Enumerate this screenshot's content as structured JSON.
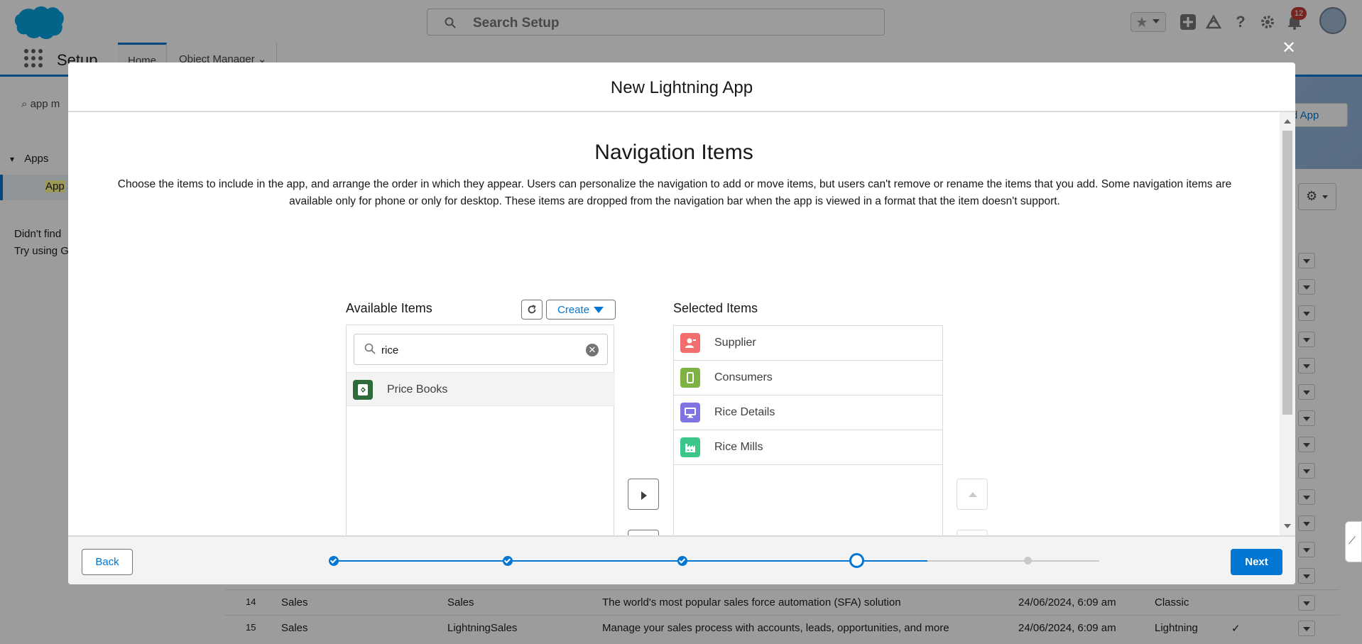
{
  "header": {
    "search_placeholder": "Search Setup",
    "notification_count": "12"
  },
  "nav": {
    "app_name": "Setup",
    "tabs": [
      {
        "label": "Home",
        "active": true
      },
      {
        "label": "Object Manager",
        "active": false
      }
    ]
  },
  "left_panel": {
    "quick_find_value": "app m",
    "tree_root": "Apps",
    "tree_child": "App",
    "help_line1": "Didn't find",
    "help_line2": "Try using G"
  },
  "background_page": {
    "new_app_button": "d App",
    "rows": [
      {
        "num": "14",
        "app_name": "Sales",
        "developer_name": "Sales",
        "description": "The world's most popular sales force automation (SFA) solution",
        "last_modified": "24/06/2024, 6:09 am",
        "app_type": "Classic",
        "visible_in_lightning": false
      },
      {
        "num": "15",
        "app_name": "Sales",
        "developer_name": "LightningSales",
        "description": "Manage your sales process with accounts, leads, opportunities, and more",
        "last_modified": "24/06/2024, 6:09 am",
        "app_type": "Lightning",
        "visible_in_lightning": true
      }
    ]
  },
  "modal": {
    "title": "New Lightning App",
    "section_title": "Navigation Items",
    "description": "Choose the items to include in the app, and arrange the order in which they appear. Users can personalize the navigation to add or move items, but users can't remove or rename the items that you add. Some navigation items are available only for phone or only for desktop. These items are dropped from the navigation bar when the app is viewed in a format that the item doesn't support.",
    "available": {
      "label": "Available Items",
      "create_label": "Create",
      "search_value": "rice",
      "items": [
        {
          "label": "Price Books",
          "icon": "price-book-icon",
          "color": "#2e6b3a"
        }
      ]
    },
    "selected": {
      "label": "Selected Items",
      "items": [
        {
          "label": "Supplier",
          "icon": "person-icon",
          "color": "#f26d6d"
        },
        {
          "label": "Consumers",
          "icon": "phone-icon",
          "color": "#7cb342"
        },
        {
          "label": "Rice Details",
          "icon": "monitor-icon",
          "color": "#7f74e1"
        },
        {
          "label": "Rice Mills",
          "icon": "factory-icon",
          "color": "#3cc68a"
        }
      ]
    },
    "footer": {
      "back_label": "Back",
      "next_label": "Next",
      "progress": {
        "total_steps": 5,
        "current_step": 4
      }
    }
  },
  "colors": {
    "brand": "#0176d3",
    "header_bar": "#ffffff"
  }
}
